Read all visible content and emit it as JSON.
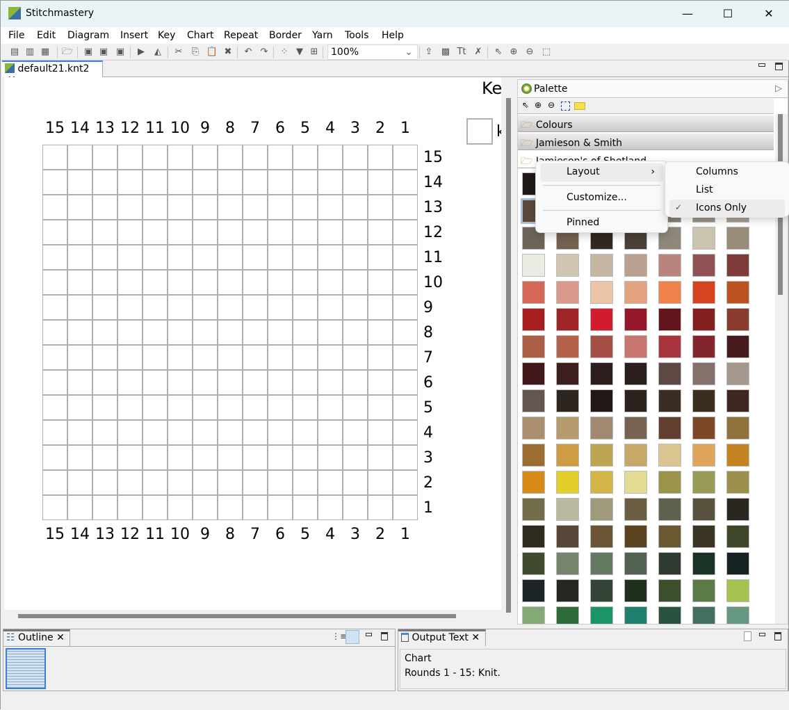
{
  "window": {
    "title": "Stitchmastery",
    "minimize": "—",
    "maximize": "☐",
    "close": "✕"
  },
  "menu": [
    "File",
    "Edit",
    "Diagram",
    "Insert",
    "Key",
    "Chart",
    "Repeat",
    "Border",
    "Yarn",
    "Tools",
    "Help"
  ],
  "toolbar": {
    "zoom": "100%",
    "icons": [
      "new-file-icon",
      "new-chart-icon",
      "new-image-icon",
      "open-folder-icon",
      "save-icon",
      "save-as-icon",
      "save-all-icon",
      "play-icon",
      "mirror-icon",
      "cut-icon",
      "copy-icon",
      "paste-icon",
      "delete-icon",
      "undo-icon",
      "redo-icon",
      "select-layout-icon",
      "dropdown-icon",
      "arrange-icon"
    ],
    "icons2": [
      "import-icon",
      "export-icon",
      "text-format-icon",
      "remove-icon",
      "pointer-icon",
      "zoom-in-icon",
      "zoom-out-icon",
      "marquee-icon"
    ]
  },
  "editor": {
    "tab": "default21.knt2",
    "close": "✕",
    "key_title": "Ke",
    "key_label": "k"
  },
  "chart": {
    "columns": [
      "15",
      "14",
      "13",
      "12",
      "11",
      "10",
      "9",
      "8",
      "7",
      "6",
      "5",
      "4",
      "3",
      "2",
      "1"
    ],
    "rows": [
      "15",
      "14",
      "13",
      "12",
      "11",
      "10",
      "9",
      "8",
      "7",
      "6",
      "5",
      "4",
      "3",
      "2",
      "1"
    ]
  },
  "palette": {
    "title": "Palette",
    "drawers": [
      "Colours",
      "Jamieson & Smith",
      "Jamieson's of Shetland"
    ],
    "swatches": [
      [
        "#1f1a17",
        "#2a2420",
        "#3a312a",
        "#4a4038",
        "#6b6258",
        "#8a8070",
        "#a09888"
      ],
      [
        "#5b4a3b",
        "#6e6456",
        "#7a7268",
        "#857c70",
        "#8a8478",
        "#9a9486",
        "#a8a091"
      ],
      [
        "#6b6558",
        "#72614f",
        "#322822",
        "#4a4035",
        "#8e877a",
        "#c9c3b0",
        "#998b7a"
      ],
      [
        "#ecebe3",
        "#d0c5b0",
        "#c6b7a3",
        "#bca08f",
        "#b9837e",
        "#915253",
        "#7d3a36"
      ],
      [
        "#d56757",
        "#d99a8d",
        "#ecc4a7",
        "#e4a37e",
        "#f0834b",
        "#d6441f",
        "#bd5221"
      ],
      [
        "#a81f1f",
        "#9e2428",
        "#d01c2d",
        "#941628",
        "#64151b",
        "#841f1f",
        "#8a392d"
      ],
      [
        "#ac5f47",
        "#b5624b",
        "#a54f47",
        "#c97671",
        "#a7333c",
        "#82252d",
        "#471b1b"
      ],
      [
        "#42181a",
        "#3d1f20",
        "#2c1c1c",
        "#2b1f1e",
        "#5e4844",
        "#85716c",
        "#a4978c"
      ],
      [
        "#645752",
        "#2d2520",
        "#211815",
        "#2c231e",
        "#3a2e24",
        "#3b2e21",
        "#3e251d"
      ],
      [
        "#ab9170",
        "#b59a6e",
        "#a08970",
        "#766350",
        "#633f30",
        "#7b4927",
        "#91723c"
      ],
      [
        "#9b6e30",
        "#cd9c43",
        "#bea452",
        "#c8a868",
        "#dac490",
        "#dea55b",
        "#c58323"
      ],
      [
        "#d78c19",
        "#e2cf2a",
        "#d2b447",
        "#e3da94",
        "#9a9349",
        "#979b55",
        "#9c904f"
      ],
      [
        "#716d49",
        "#bab99f",
        "#9e9a7a",
        "#6c5e43",
        "#60604e",
        "#58513e",
        "#2a2620"
      ],
      [
        "#2e2a1d",
        "#574638",
        "#6a5433",
        "#5b421f",
        "#6a5930",
        "#3a3523",
        "#3e4729"
      ],
      [
        "#3f4a2e",
        "#77836a",
        "#637a60",
        "#536153",
        "#2e3a30",
        "#1a3326",
        "#172223"
      ],
      [
        "#1c2427",
        "#242820",
        "#334335",
        "#1f301c",
        "#3c4e2c",
        "#5b7a45",
        "#a5c250"
      ],
      [
        "#83aa74",
        "#2d6b38",
        "#1c9466",
        "#208070",
        "#285240",
        "#426f5f",
        "#669883"
      ]
    ]
  },
  "context_menu": {
    "layout": "Layout",
    "customize": "Customize...",
    "pinned": "Pinned",
    "submenu": {
      "columns": "Columns",
      "list": "List",
      "icons_only": "Icons Only",
      "checked": "✓"
    }
  },
  "outline": {
    "tab": "Outline",
    "close": "✕"
  },
  "output": {
    "tab": "Output Text",
    "close": "✕",
    "lines": [
      "Chart",
      "Rounds 1 - 15: Knit."
    ]
  }
}
